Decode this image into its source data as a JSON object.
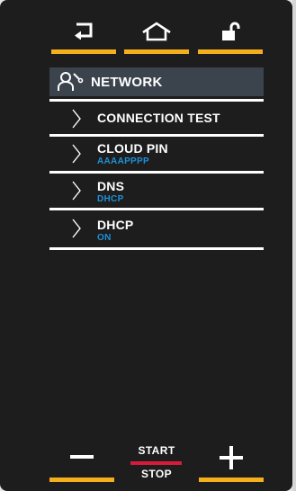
{
  "nav": {
    "back_icon": "back-arrow-icon",
    "home_icon": "home-icon",
    "lock_icon": "unlock-icon",
    "accent_color": "#f4b01c"
  },
  "header": {
    "icon": "user-wrench-icon",
    "title": "NETWORK"
  },
  "items": [
    {
      "label": "CONNECTION TEST",
      "value": ""
    },
    {
      "label": "CLOUD PIN",
      "value": "AAAAPPPP"
    },
    {
      "label": "DNS",
      "value": "DHCP"
    },
    {
      "label": "DHCP",
      "value": "ON"
    }
  ],
  "controls": {
    "minus_icon": "minus-icon",
    "plus_icon": "plus-icon",
    "start_label": "START",
    "stop_label": "STOP",
    "start_stop_color": "#d81b3c",
    "value_color": "#1e90d8"
  }
}
